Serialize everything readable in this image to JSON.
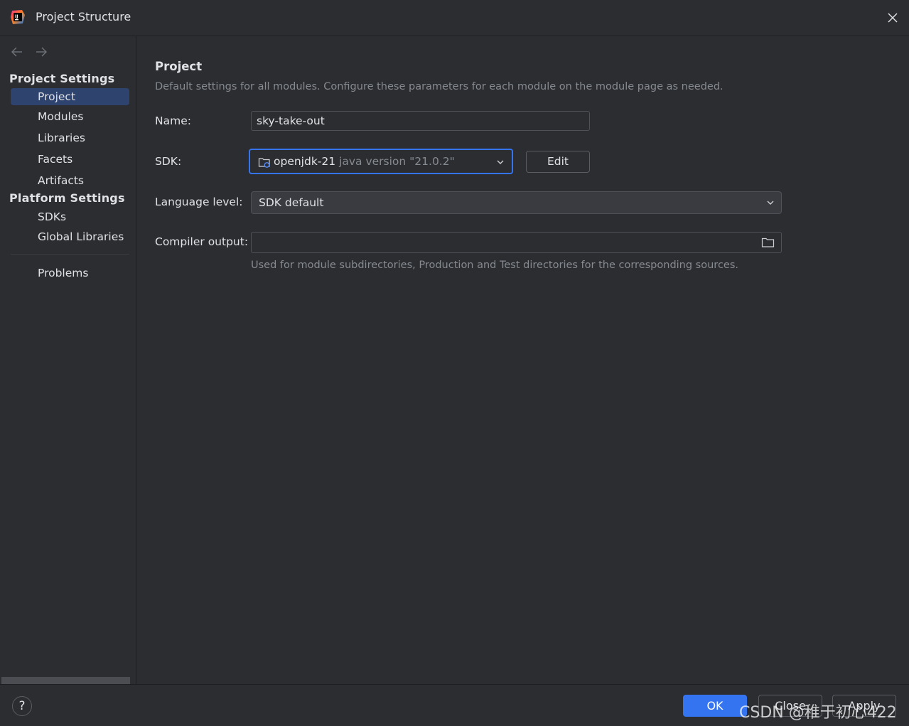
{
  "window": {
    "title": "Project Structure"
  },
  "sidebar": {
    "sections": [
      {
        "title": "Project Settings",
        "items": [
          {
            "label": "Project",
            "selected": true
          },
          {
            "label": "Modules"
          },
          {
            "label": "Libraries"
          },
          {
            "label": "Facets"
          },
          {
            "label": "Artifacts"
          }
        ]
      },
      {
        "title": "Platform Settings",
        "items": [
          {
            "label": "SDKs"
          },
          {
            "label": "Global Libraries"
          }
        ]
      }
    ],
    "problems_label": "Problems"
  },
  "main": {
    "title": "Project",
    "description": "Default settings for all modules. Configure these parameters for each module on the module page as needed.",
    "name_label": "Name:",
    "name_value": "sky-take-out",
    "sdk_label": "SDK:",
    "sdk_name": "openjdk-21",
    "sdk_version": "java version \"21.0.2\"",
    "edit_button": "Edit",
    "language_level_label": "Language level:",
    "language_level_value": "SDK default",
    "compiler_output_label": "Compiler output:",
    "compiler_output_value": "",
    "compiler_output_hint": "Used for module subdirectories, Production and Test directories for the corresponding sources."
  },
  "footer": {
    "help_label": "?",
    "ok_label": "OK",
    "close_label": "Close",
    "apply_label": "Apply",
    "watermark": "CSDN @稚于初心422"
  },
  "colors": {
    "background": "#2b2d30",
    "accent": "#3574f0",
    "selection": "#2e436e",
    "text": "#dfe1e5",
    "muted": "#868a91"
  }
}
